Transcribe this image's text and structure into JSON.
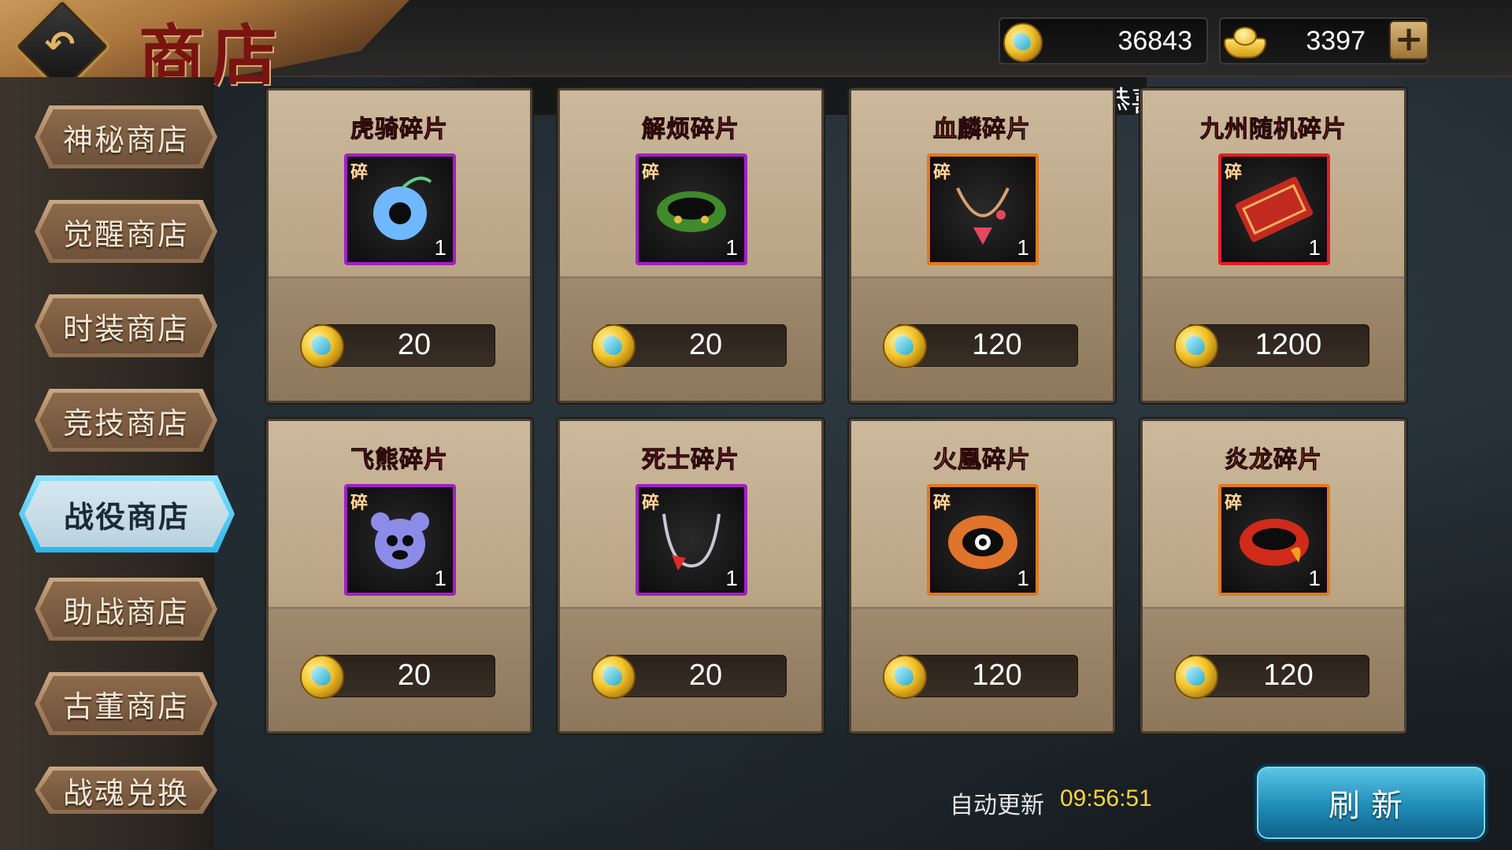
{
  "header": {
    "title": "商店",
    "back_icon": "back-arrow-icon"
  },
  "currency": {
    "coins": {
      "icon": "coin-icon",
      "value": "36843"
    },
    "ingots": {
      "icon": "gold-ingot-icon",
      "value": "3397"
    },
    "add_label": "+"
  },
  "marquee": {
    "text": "恭喜"
  },
  "sidebar": {
    "items": [
      {
        "label": "神秘商店",
        "active": false
      },
      {
        "label": "觉醒商店",
        "active": false
      },
      {
        "label": "时装商店",
        "active": false
      },
      {
        "label": "竞技商店",
        "active": false
      },
      {
        "label": "战役商店",
        "active": true
      },
      {
        "label": "助战商店",
        "active": false
      },
      {
        "label": "古董商店",
        "active": false
      },
      {
        "label": "战魂兑换",
        "active": false
      }
    ]
  },
  "products": [
    {
      "name": "虎骑碎片",
      "name_color": "#e0207a",
      "tag": "碎",
      "qty": "1",
      "price": "20",
      "frame": "purple"
    },
    {
      "name": "解烦碎片",
      "name_color": "#e0207a",
      "tag": "碎",
      "qty": "1",
      "price": "20",
      "frame": "purple"
    },
    {
      "name": "血麟碎片",
      "name_color": "#ff7a1a",
      "tag": "碎",
      "qty": "1",
      "price": "120",
      "frame": "orange"
    },
    {
      "name": "九州随机碎片",
      "name_color": "#ff2a2a",
      "tag": "碎",
      "qty": "1",
      "price": "1200",
      "frame": "red"
    },
    {
      "name": "飞熊碎片",
      "name_color": "#e0207a",
      "tag": "碎",
      "qty": "1",
      "price": "20",
      "frame": "purple"
    },
    {
      "name": "死士碎片",
      "name_color": "#e0207a",
      "tag": "碎",
      "qty": "1",
      "price": "20",
      "frame": "purple"
    },
    {
      "name": "火凰碎片",
      "name_color": "#ff7a1a",
      "tag": "碎",
      "qty": "1",
      "price": "120",
      "frame": "orange"
    },
    {
      "name": "炎龙碎片",
      "name_color": "#ff7a1a",
      "tag": "碎",
      "qty": "1",
      "price": "120",
      "frame": "orange"
    }
  ],
  "footer": {
    "auto_refresh_label": "自动更新",
    "countdown": "09:56:51",
    "refresh_label": "刷新"
  }
}
